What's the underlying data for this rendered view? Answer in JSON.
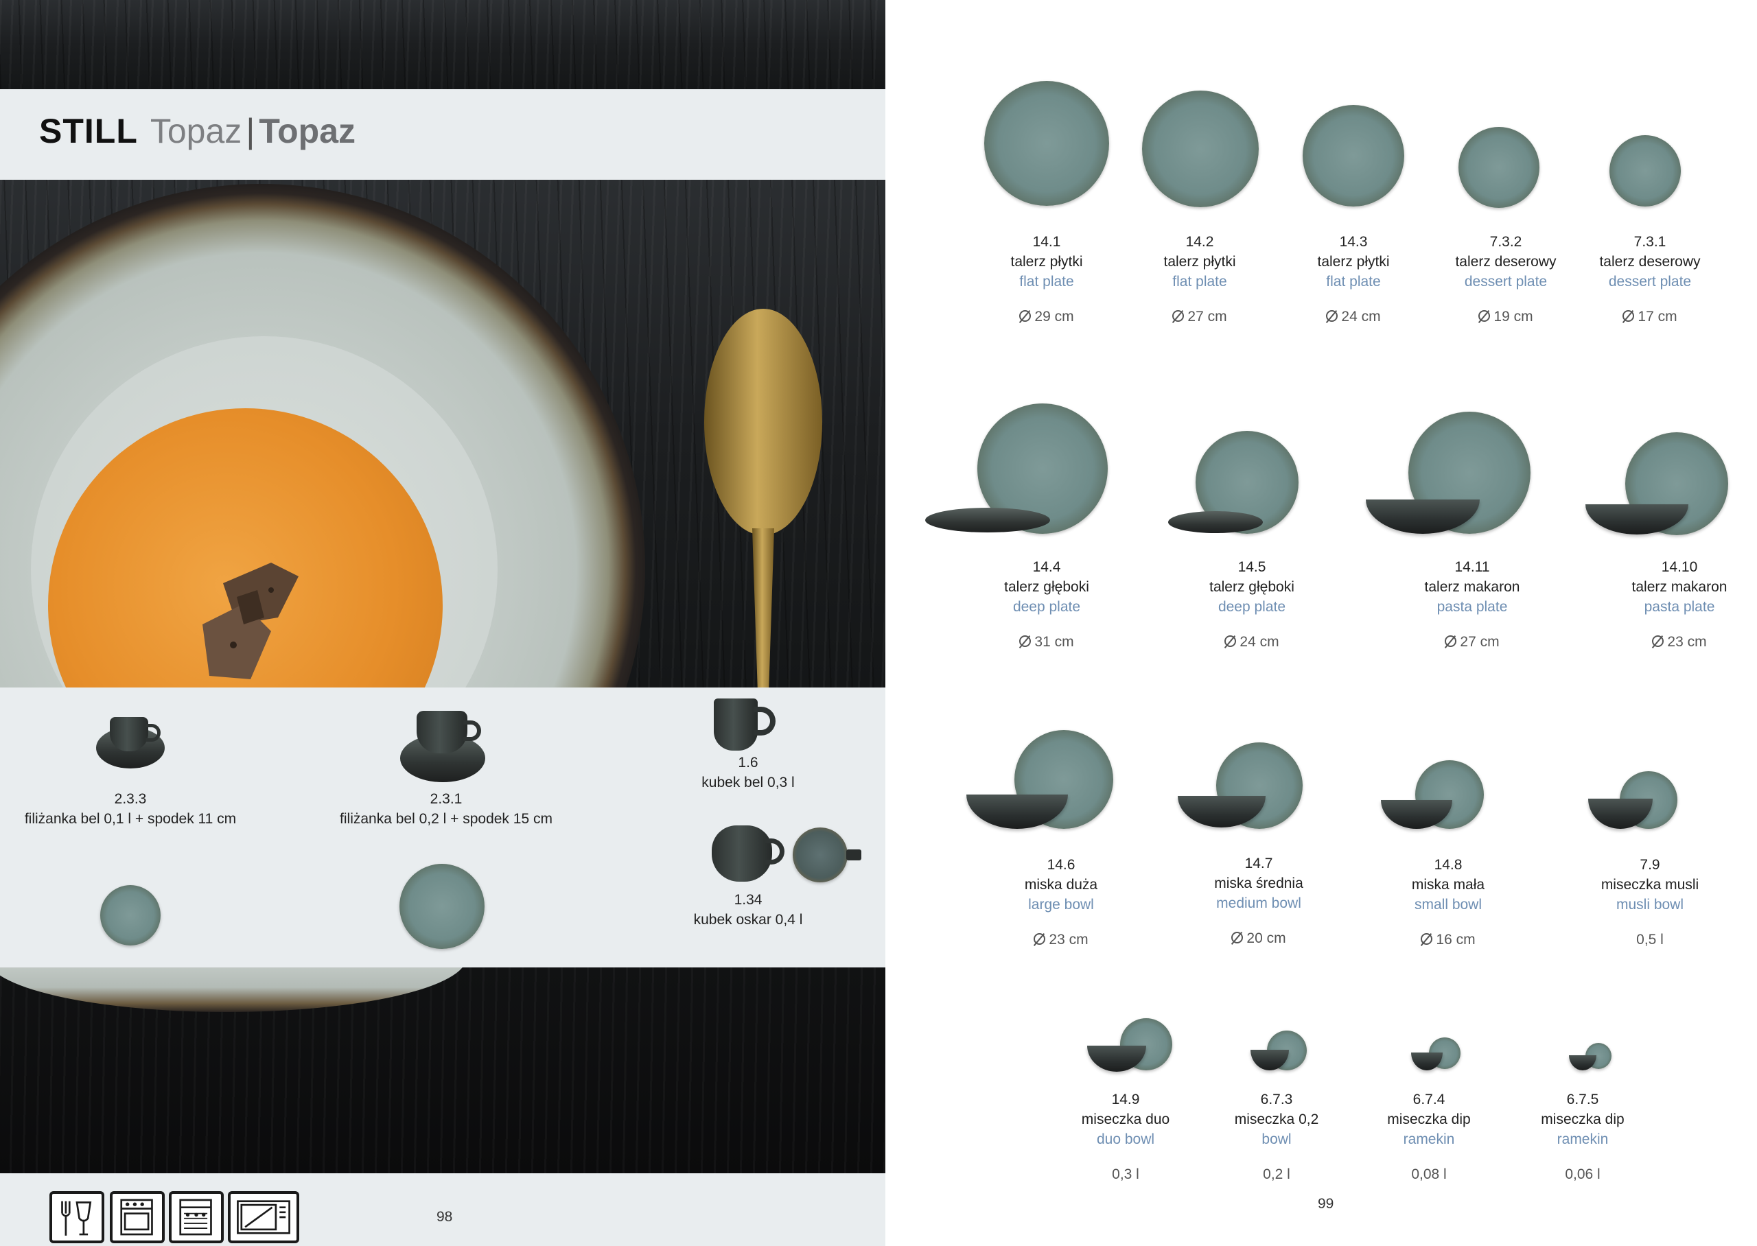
{
  "header": {
    "brand": "STILL",
    "subtitle_pl": "Topaz",
    "separator": "|",
    "subtitle_en": "Topaz"
  },
  "left_products": [
    {
      "code": "2.3.3",
      "name": "filiżanka bel 0,1 l + spodek 11 cm"
    },
    {
      "code": "2.3.1",
      "name": "filiżanka bel 0,2 l + spodek 15 cm"
    },
    {
      "code": "1.6",
      "name": "kubek bel 0,3 l"
    },
    {
      "code": "1.34",
      "name": "kubek oskar 0,4 l"
    }
  ],
  "care_icons": [
    "food-safe-icon",
    "oven-icon",
    "dishwasher-icon",
    "microwave-icon"
  ],
  "pages": {
    "left": "98",
    "right": "99"
  },
  "right_products": [
    {
      "code": "14.1",
      "pl": "talerz płytki",
      "en": "flat plate",
      "size": "29 cm"
    },
    {
      "code": "14.2",
      "pl": "talerz płytki",
      "en": "flat plate",
      "size": "27 cm"
    },
    {
      "code": "14.3",
      "pl": "talerz płytki",
      "en": "flat plate",
      "size": "24 cm"
    },
    {
      "code": "7.3.2",
      "pl": "talerz deserowy",
      "en": "dessert plate",
      "size": "19 cm"
    },
    {
      "code": "7.3.1",
      "pl": "talerz deserowy",
      "en": "dessert plate",
      "size": "17 cm"
    },
    {
      "code": "14.4",
      "pl": "talerz głęboki",
      "en": "deep plate",
      "size": "31 cm"
    },
    {
      "code": "14.5",
      "pl": "talerz głęboki",
      "en": "deep plate",
      "size": "24 cm"
    },
    {
      "code": "14.11",
      "pl": "talerz makaron",
      "en": "pasta plate",
      "size": "27 cm"
    },
    {
      "code": "14.10",
      "pl": "talerz makaron",
      "en": "pasta plate",
      "size": "23 cm"
    },
    {
      "code": "14.6",
      "pl": "miska duża",
      "en": "large bowl",
      "size": "23 cm"
    },
    {
      "code": "14.7",
      "pl": "miska średnia",
      "en": "medium bowl",
      "size": "20 cm"
    },
    {
      "code": "14.8",
      "pl": "miska mała",
      "en": "small bowl",
      "size": "16 cm"
    },
    {
      "code": "7.9",
      "pl": "miseczka musli",
      "en": "musli bowl",
      "size": "0,5 l"
    },
    {
      "code": "14.9",
      "pl": "miseczka duo",
      "en": "duo bowl",
      "size": "0,3 l"
    },
    {
      "code": "6.7.3",
      "pl": "miseczka 0,2",
      "en": "bowl",
      "size": "0,2 l"
    },
    {
      "code": "6.7.4",
      "pl": "miseczka dip",
      "en": "ramekin",
      "size": "0,08 l"
    },
    {
      "code": "6.7.5",
      "pl": "miseczka dip",
      "en": "ramekin",
      "size": "0,06 l"
    }
  ]
}
